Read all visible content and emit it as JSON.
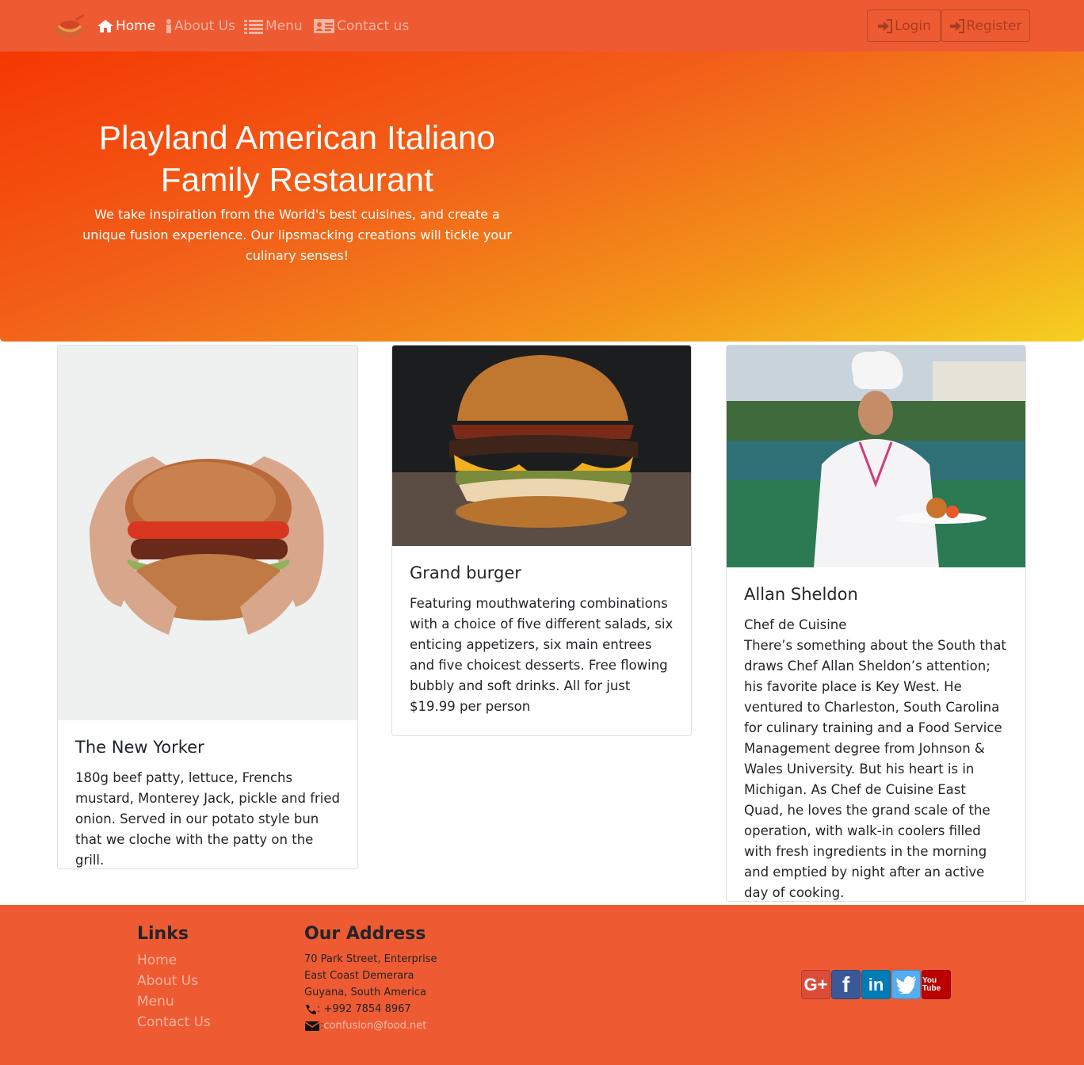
{
  "nav": {
    "items": [
      {
        "label": "Home",
        "icon": "home-icon"
      },
      {
        "label": "About Us",
        "icon": "info-icon"
      },
      {
        "label": "Menu",
        "icon": "list-icon"
      },
      {
        "label": "Contact us",
        "icon": "address-card-icon"
      }
    ],
    "login_label": "Login",
    "register_label": "Register"
  },
  "hero": {
    "title": "Playland American Italiano Family Restaurant",
    "subtitle": "We take inspiration from the World's best cuisines, and create a unique fusion experience. Our lipsmacking creations will tickle your culinary senses!"
  },
  "cards": [
    {
      "title": "The New Yorker",
      "text": "180g beef patty, lettuce, Frenchs mustard, Monterey Jack, pickle and fried onion. Served in our potato style bun that we cloche with the patty on the grill."
    },
    {
      "title": "Grand burger",
      "text": "Featuring mouthwatering combinations with a choice of five different salads, six enticing appetizers, six main entrees and five choicest desserts. Free flowing bubbly and soft drinks. All for just $19.99 per person"
    },
    {
      "title": "Allan Sheldon",
      "subtitle": "Chef de Cuisine",
      "text": "There’s something about the South that draws Chef Allan Sheldon’s attention; his favorite place is Key West. He ventured to Charleston, South Carolina for culinary training and a Food Service Management degree from Johnson & Wales University. But his heart is in Michigan. As Chef de Cuisine East Quad, he loves the grand scale of the operation, with walk-in coolers filled with fresh ingredients in the morning and emptied by night after an active day of cooking."
    }
  ],
  "footer": {
    "links_heading": "Links",
    "links": [
      "Home",
      "About Us",
      "Menu",
      "Contact Us"
    ],
    "address_heading": "Our Address",
    "address_lines": [
      "70 Park Street, Enterprise",
      "East Coast Demerara",
      "Guyana, South America"
    ],
    "phone": ": +992 7854 8967",
    "email": "confusion@food.net",
    "social": [
      {
        "icon": "google-plus-icon",
        "label": "G+",
        "color": "#dd4b39"
      },
      {
        "icon": "facebook-icon",
        "label": "f",
        "color": "#3b5998"
      },
      {
        "icon": "linkedin-icon",
        "label": "in",
        "color": "#007bb6"
      },
      {
        "icon": "twitter-icon",
        "label": "",
        "color": "#55acee"
      },
      {
        "icon": "youtube-icon",
        "label": "You Tube",
        "color": "#bb0000"
      }
    ]
  },
  "colors": {
    "navbar": "#ee5a32",
    "footer": "#ee5a32",
    "hero_start": "#f53803",
    "hero_end": "#f5d020"
  }
}
